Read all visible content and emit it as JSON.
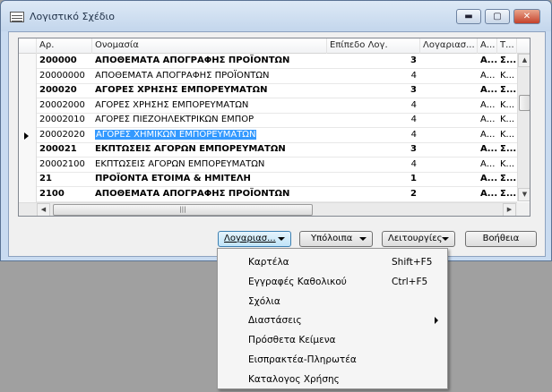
{
  "window": {
    "title": "Λογιστικό Σχέδιο",
    "minimize_icon": "minimize-icon",
    "maximize_icon": "maximize-icon",
    "close_icon": "close-icon"
  },
  "grid": {
    "columns": [
      "Αρ.",
      "Ονομασία",
      "Επίπεδο Λογ.",
      "Λογαριασ...",
      "Α...",
      "Τ..."
    ],
    "rows": [
      {
        "no": "200000",
        "name": "ΑΠΟΘΕΜΑΤΑ ΑΠΟΓΡΑΦΗΣ ΠΡΟΪΟΝΤΩΝ",
        "level": "3",
        "col4": "",
        "col5": "Α...",
        "col6": "Σ...",
        "bold": true
      },
      {
        "no": "20000000",
        "name": "ΑΠΟΘΕΜΑΤΑ ΑΠΟΓΡΑΦΗΣ ΠΡΟΪΟΝΤΩΝ",
        "level": "4",
        "col4": "",
        "col5": "Α...",
        "col6": "Κ...",
        "bold": false
      },
      {
        "no": "200020",
        "name": "ΑΓΟΡΕΣ ΧΡΗΣΗΣ ΕΜΠΟΡΕΥΜΑΤΩΝ",
        "level": "3",
        "col4": "",
        "col5": "Α...",
        "col6": "Σ...",
        "bold": true
      },
      {
        "no": "20002000",
        "name": "ΑΓΟΡΕΣ ΧΡΗΣΗΣ ΕΜΠΟΡΕΥΜΑΤΩΝ",
        "level": "4",
        "col4": "",
        "col5": "Α...",
        "col6": "Κ...",
        "bold": false
      },
      {
        "no": "20002010",
        "name": "ΑΓΟΡΕΣ ΠΙΕΖΟΗΛΕΚΤΡΙΚΩΝ ΕΜΠΟΡ",
        "level": "4",
        "col4": "",
        "col5": "Α...",
        "col6": "Κ...",
        "bold": false
      },
      {
        "no": "20002020",
        "name": "ΑΓΟΡΕΣ ΧΗΜΙΚΩΝ ΕΜΠΟΡΕΥΜΑΤΩΝ",
        "level": "4",
        "col4": "",
        "col5": "Α...",
        "col6": "Κ...",
        "bold": false,
        "selected": true
      },
      {
        "no": "200021",
        "name": "ΕΚΠΤΩΣΕΙΣ ΑΓΟΡΩΝ ΕΜΠΟΡΕΥΜΑΤΩΝ",
        "level": "3",
        "col4": "",
        "col5": "Α...",
        "col6": "Σ...",
        "bold": true
      },
      {
        "no": "20002100",
        "name": "ΕΚΠΤΩΣΕΙΣ ΑΓΟΡΩΝ ΕΜΠΟΡΕΥΜΑΤΩΝ",
        "level": "4",
        "col4": "",
        "col5": "Α...",
        "col6": "Κ...",
        "bold": false
      },
      {
        "no": "21",
        "name": "ΠΡΟΪΟΝΤΑ ΕΤΟΙΜΑ & ΗΜΙΤΕΛΗ",
        "level": "1",
        "col4": "",
        "col5": "Α...",
        "col6": "Σ...",
        "bold": true
      },
      {
        "no": "2100",
        "name": "ΑΠΟΘΕΜΑΤΑ ΑΠΟΓΡΑΦΗΣ ΠΡΟΪΟΝΤΩΝ",
        "level": "2",
        "col4": "",
        "col5": "Α...",
        "col6": "Σ...",
        "bold": true
      }
    ]
  },
  "buttons": {
    "accounts": "Λογαριασ...",
    "balances": "Υπόλοιπα",
    "functions": "Λειτουργίες",
    "help": "Βοήθεια"
  },
  "menu": {
    "items": [
      {
        "label": "Καρτέλα",
        "shortcut": "Shift+F5"
      },
      {
        "label": "Εγγραφές Καθολικού",
        "shortcut": "Ctrl+F5"
      },
      {
        "label": "Σχόλια",
        "shortcut": ""
      },
      {
        "label": "Διαστάσεις",
        "shortcut": "",
        "submenu": true
      },
      {
        "label": "Πρόσθετα Κείμενα",
        "shortcut": ""
      },
      {
        "label": "Εισπρακτέα-Πληρωτέα",
        "shortcut": ""
      },
      {
        "label": "Καταλογος Χρήσης",
        "shortcut": ""
      }
    ]
  },
  "colors": {
    "selection": "#3399ff",
    "window_bg": "#c9dbf0",
    "desktop": "#a0a0a0"
  }
}
